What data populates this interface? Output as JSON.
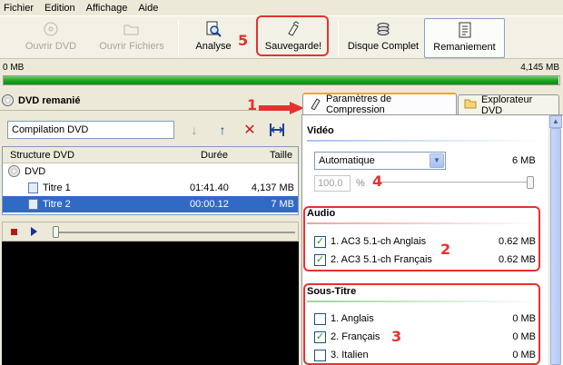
{
  "menu": [
    "Fichier",
    "Edition",
    "Affichage",
    "Aide"
  ],
  "toolbar": {
    "open_dvd": "Ouvrir DVD",
    "open_files": "Ouvrir Fichiers",
    "analyse": "Analyse",
    "save": "Sauvegarde!",
    "full_disc": "Disque Complet",
    "rework": "Remaniement"
  },
  "capacity": {
    "min_label": "0 MB",
    "max_label": "4,145 MB",
    "fill_fraction": 0.998
  },
  "left": {
    "title": "DVD remanié",
    "name_value": "Compilation DVD",
    "tree": {
      "headers": [
        "Structure DVD",
        "Durée",
        "Taille"
      ],
      "root": "DVD",
      "rows": [
        {
          "name": "Titre 1",
          "duration": "01:41.40",
          "size": "4,137 MB",
          "selected": false
        },
        {
          "name": "Titre 2",
          "duration": "00:00.12",
          "size": "7 MB",
          "selected": true
        }
      ]
    }
  },
  "tabs": [
    {
      "label": "Paramètres de Compression",
      "active": true,
      "icon": "compression-icon"
    },
    {
      "label": "Explorateur DVD",
      "active": false,
      "icon": "folder-icon"
    }
  ],
  "video": {
    "heading": "Vidéo",
    "mode": "Automatique",
    "size": "6 MB",
    "quality": "100.0",
    "unit": "%"
  },
  "audio": {
    "heading": "Audio",
    "tracks": [
      {
        "label": "1. AC3 5.1-ch Anglais",
        "size": "0.62 MB",
        "checked": true
      },
      {
        "label": "2. AC3 5.1-ch Français",
        "size": "0.62 MB",
        "checked": true
      }
    ]
  },
  "subtitles": {
    "heading": "Sous-Titre",
    "tracks": [
      {
        "label": "1. Anglais",
        "size": "0 MB",
        "checked": false
      },
      {
        "label": "2. Français",
        "size": "0 MB",
        "checked": true
      },
      {
        "label": "3. Italien",
        "size": "0 MB",
        "checked": false
      }
    ]
  },
  "annotations": [
    "1",
    "2",
    "3",
    "4",
    "5"
  ],
  "colors": {
    "annotation": "#e4322f",
    "progress": "#1ba21b",
    "selection": "#316ac5",
    "active_tab": "#f6a71d"
  }
}
